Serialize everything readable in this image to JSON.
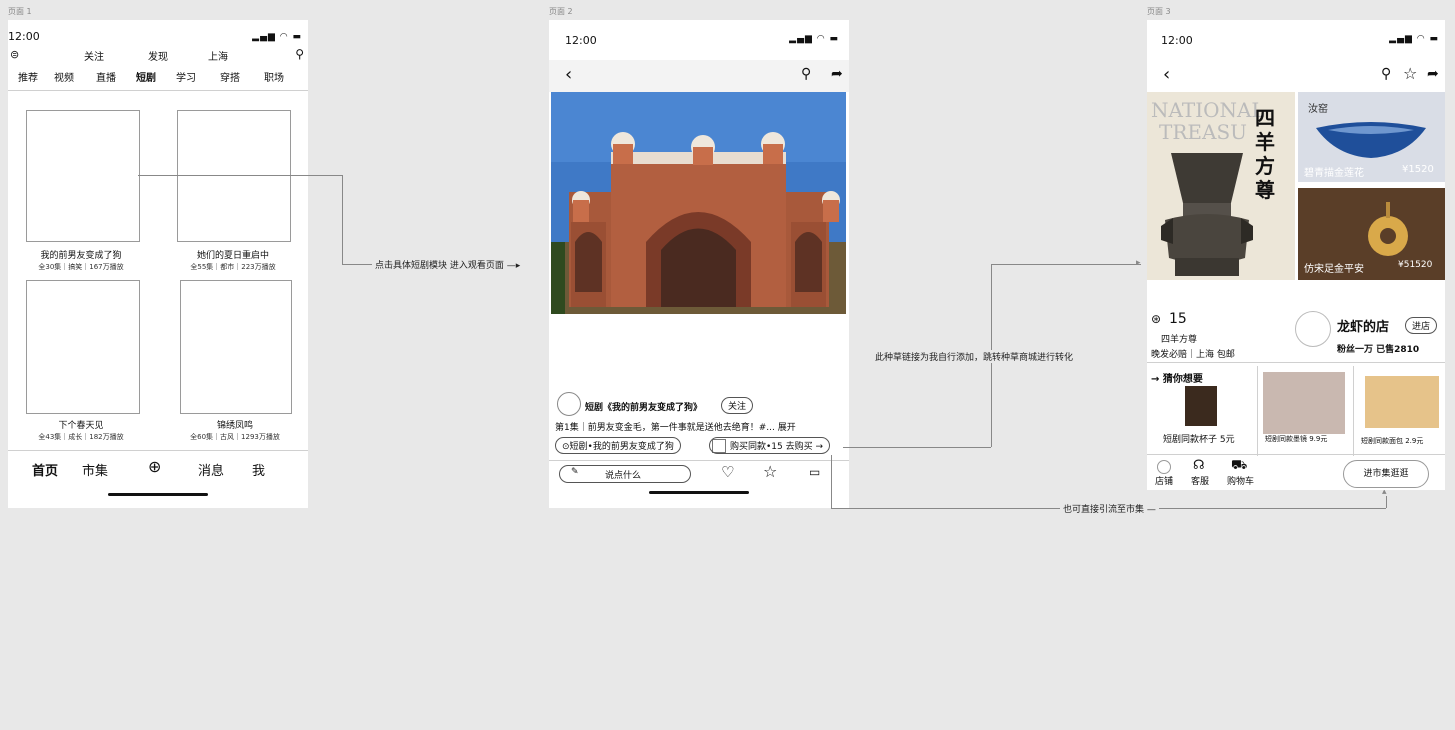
{
  "labels": {
    "page1": "页面 1",
    "page2": "页面 2",
    "page3": "页面 3"
  },
  "status": {
    "time": "12:00",
    "signal": "▂▄▆ ◠ ▬"
  },
  "p1": {
    "top": {
      "follow": "关注",
      "discover": "发现",
      "city": "上海"
    },
    "tabs": [
      "推荐",
      "视频",
      "直播",
      "短剧",
      "学习",
      "穿搭",
      "职场"
    ],
    "cards": [
      {
        "title": "我的前男友变成了狗",
        "meta": "全30集｜搞笑｜167万播放"
      },
      {
        "title": "她们的夏日重启中",
        "meta": "全55集｜都市｜223万播放"
      },
      {
        "title": "下个春天见",
        "meta": "全43集｜成长｜182万播放"
      },
      {
        "title": "锦绣凤鸣",
        "meta": "全60集｜古风｜1293万播放"
      }
    ],
    "nav": {
      "home": "首页",
      "market": "市集",
      "add": "⊕",
      "msg": "消息",
      "me": "我"
    }
  },
  "p2": {
    "title": "短剧《我的前男友变成了狗》",
    "follow": "关注",
    "desc": "第1集｜前男友变金毛，第一件事就是送他去绝育！#... 展开",
    "drama_pill": "⊙短剧•我的前男友变成了狗",
    "buy_pill": "购买同款•15 去购买 →",
    "comment": "说点什么"
  },
  "p3": {
    "products": [
      {
        "name": "汝窑",
        "caption": "碧青描金莲花",
        "price": "¥1520"
      },
      {
        "name": "",
        "caption": "仿宋足金平安",
        "price": "¥51520"
      }
    ],
    "poster": {
      "line1": "NATIONAL",
      "line2": "TREASU",
      "chars": "四羊方尊"
    },
    "price": "15",
    "product_name": "四羊方尊",
    "tags": "晚发必赔｜上海 包邮",
    "shop": {
      "name": "龙虾的店",
      "enter": "进店",
      "stats": "粉丝一万 已售2810"
    },
    "guess_title": "→ 猜你想要",
    "recs": [
      {
        "label": "短剧同款杯子 5元"
      },
      {
        "label": "短剧同款墨镜 9.9元"
      },
      {
        "label": "短剧同款面包 2.9元"
      }
    ],
    "bottom": {
      "shop": "店铺",
      "service": "客服",
      "cart": "购物车",
      "market_btn": "进市集逛逛"
    }
  },
  "annotations": {
    "a1": "点击具体短剧模块 进入观看页面 —▸",
    "a2": "此种草链接为我自行添加，跳转种草商城进行转化",
    "a3": "也可直接引流至市集 —"
  },
  "colors": {
    "bg": "#e8e8e8",
    "line": "#888888",
    "sky": "#3d78c4",
    "brick": "#a85a3c"
  }
}
